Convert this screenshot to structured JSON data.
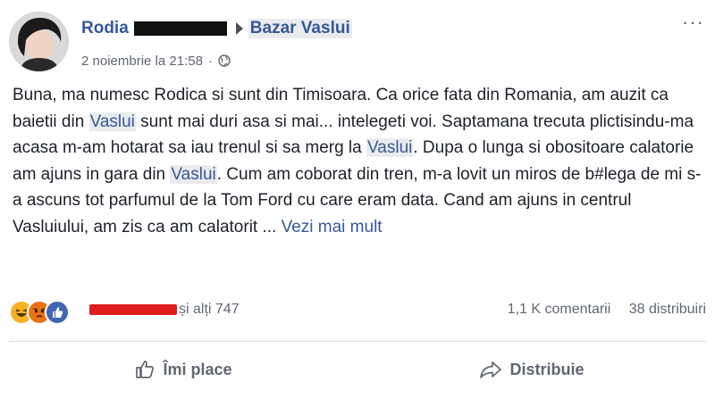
{
  "post": {
    "author_visible_name": "Rodia",
    "group_name": "Bazar Vaslui",
    "timestamp": "2 noiembrie la 21:58",
    "meta_separator": "·",
    "body": {
      "p1": "Buna, ma numesc Rodica si sunt din Timisoara. Ca orice fata din Romania, am auzit ca baietii din ",
      "link1": "Vaslui",
      "p2": " sunt mai duri asa si mai... intelegeti voi. Saptamana trecuta plictisindu-ma acasa m-am hotarat sa iau trenul si sa merg la ",
      "link2": "Vaslui",
      "p3": ". Dupa o lunga si obositoare calatorie am ajuns in gara din ",
      "link3": "Vaslui",
      "p4": ". Cum am coborat din tren, m-a lovit un miros de b#lega de mi s-a ascuns tot parfumul de la Tom Ford cu care eram data. Cand am ajuns in centrul Vasluiului, am zis ca am calatorit ... ",
      "see_more": "Vezi mai mult"
    },
    "more_menu_glyph": "···"
  },
  "reactions": {
    "icons": [
      "haha-icon",
      "angry-icon",
      "like-icon"
    ],
    "others_text": "și alți 747",
    "comments": "1,1 K comentarii",
    "shares": "38 distribuiri"
  },
  "actions": {
    "like_label": "Îmi place",
    "share_label": "Distribuie"
  },
  "colors": {
    "link": "#365899",
    "text": "#1d2129",
    "muted": "#616770",
    "like_blue": "#4267b2",
    "redaction_red": "#e01d1d"
  }
}
